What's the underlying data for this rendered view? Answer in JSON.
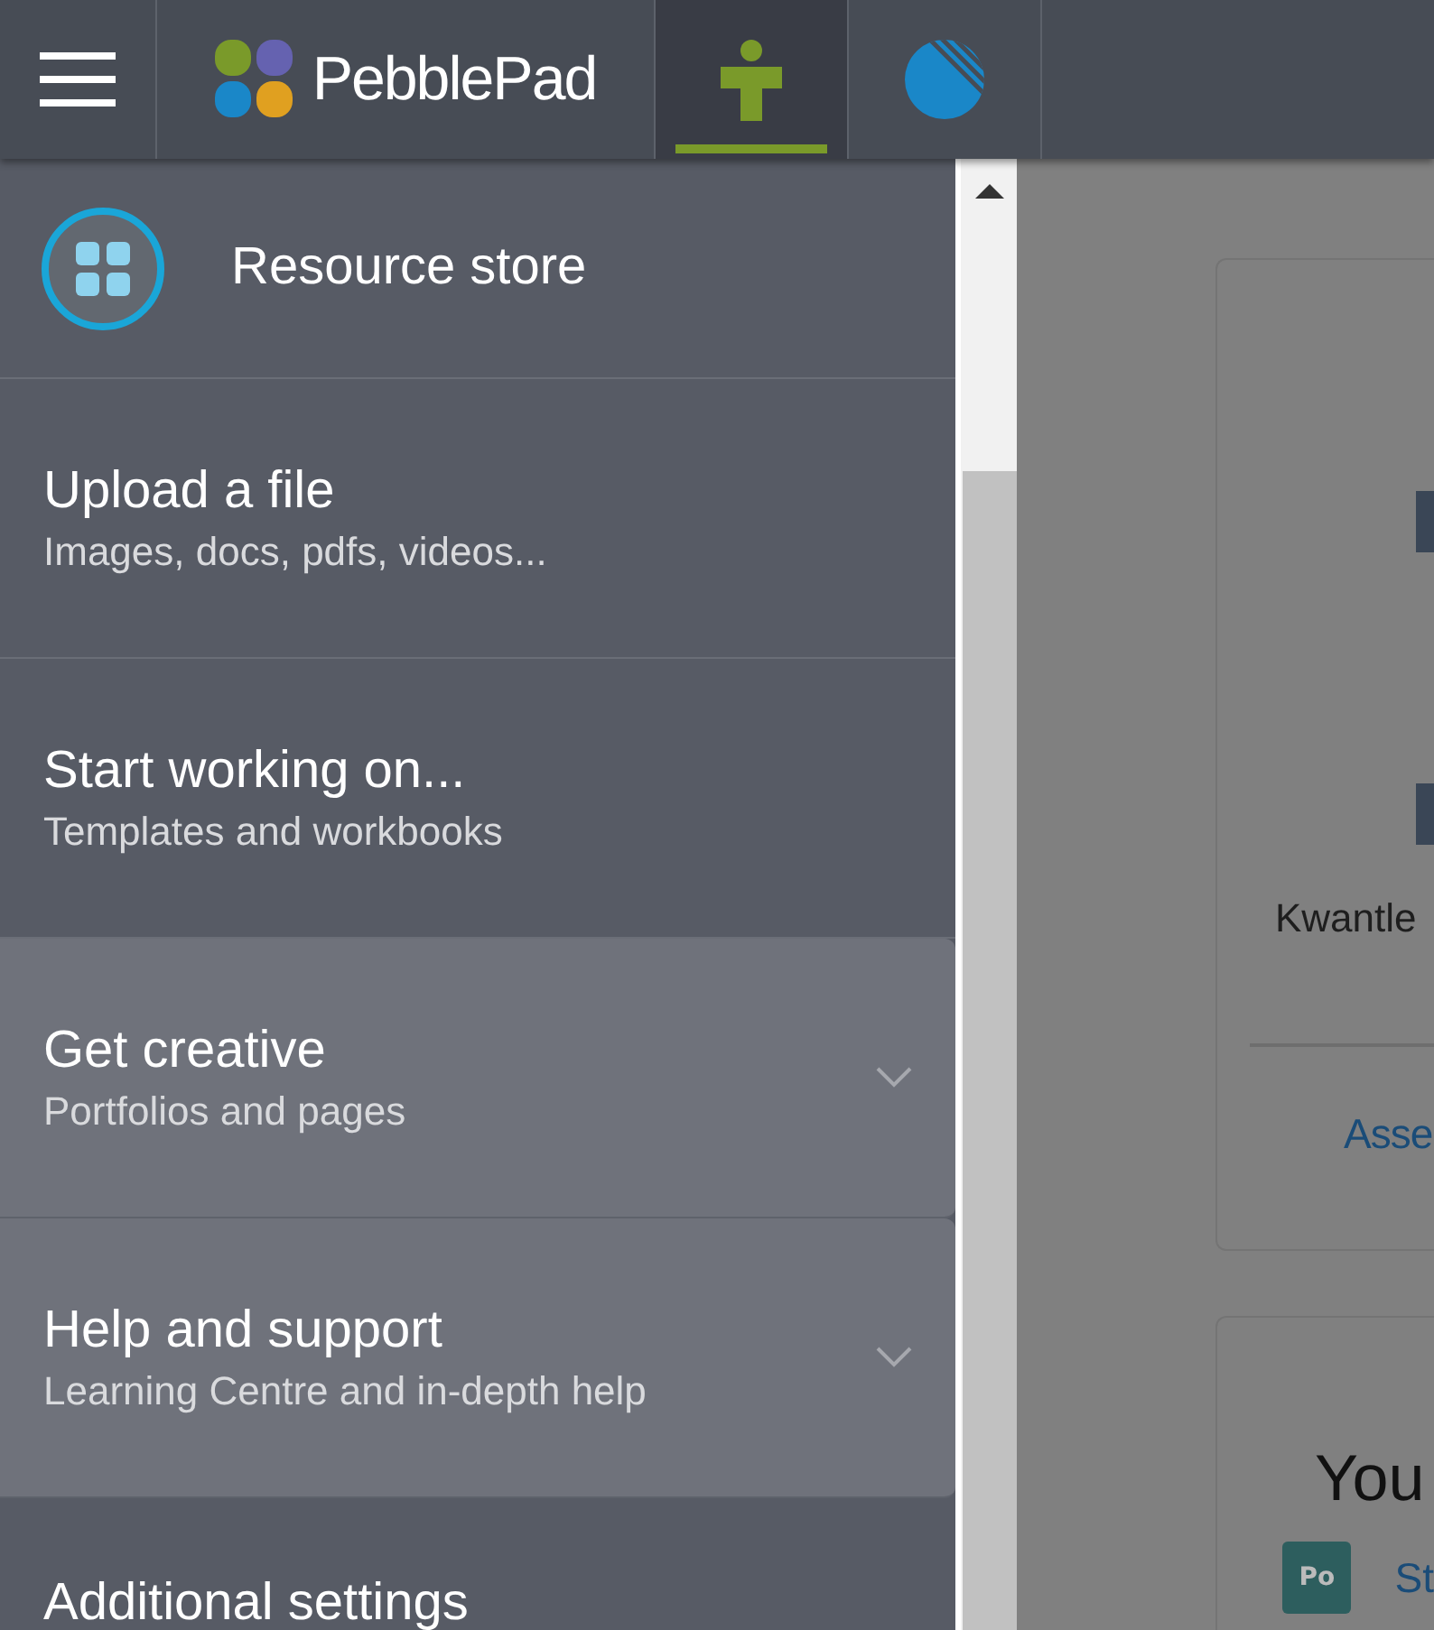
{
  "top_bar": {
    "brand": "PebblePad",
    "tabs": [
      {
        "kind": "person",
        "selected": true
      },
      {
        "kind": "striped",
        "selected": false
      }
    ]
  },
  "sidebar": {
    "items": [
      {
        "kind": "header",
        "title": "Resource store"
      },
      {
        "kind": "link",
        "title": "Upload a file",
        "subtitle": "Images, docs, pdfs, videos..."
      },
      {
        "kind": "link",
        "title": "Start working on...",
        "subtitle": "Templates and workbooks"
      },
      {
        "kind": "expandable",
        "title": "Get creative",
        "subtitle": "Portfolios and pages",
        "expanded": false
      },
      {
        "kind": "expandable",
        "title": "Help and support",
        "subtitle": "Learning Centre and in-depth help",
        "expanded": false
      },
      {
        "kind": "link",
        "title": "Additional settings"
      }
    ]
  },
  "main": {
    "cards": [
      {
        "text": "Kwantle",
        "link": "Asse"
      },
      {
        "heading": "You",
        "badge": "Po",
        "link": "St"
      }
    ]
  }
}
